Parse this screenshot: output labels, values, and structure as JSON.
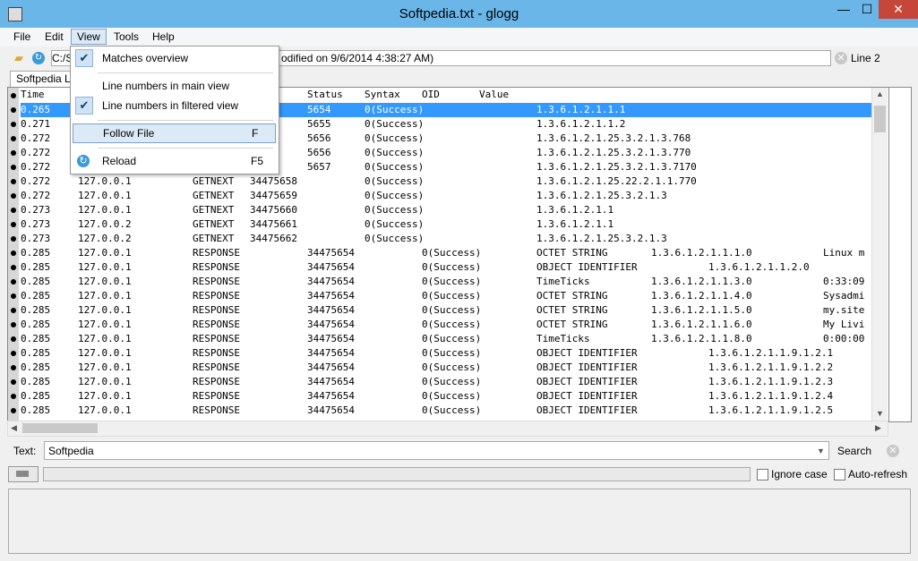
{
  "window": {
    "title": "Softpedia.txt - glogg",
    "min_label": "—",
    "max_label": "☐",
    "close_label": "✕"
  },
  "menubar": [
    "File",
    "Edit",
    "View",
    "Tools",
    "Help"
  ],
  "toolbar": {
    "path_prefix": "C:/S",
    "path_suffix": "odified on 9/6/2014 4:38:27 AM)",
    "line_indicator": "Line 2"
  },
  "tab": {
    "label": "Softpedia Lo"
  },
  "view_menu": {
    "items": [
      {
        "label": "Matches overview",
        "checked": true,
        "shortcut": ""
      },
      {
        "label": "Line numbers in main view",
        "checked": false,
        "shortcut": ""
      },
      {
        "label": "Line numbers in filtered view",
        "checked": true,
        "shortcut": ""
      },
      {
        "label": "Follow File",
        "checked": false,
        "shortcut": "F"
      },
      {
        "label": "Reload",
        "checked": false,
        "shortcut": "F5"
      }
    ]
  },
  "log": {
    "headers": [
      "Time",
      "Status",
      "Syntax",
      "OID",
      "Value"
    ],
    "rows": [
      [
        "0.265",
        "",
        "",
        "5654",
        "0(Success)",
        "1.3.6.1.2.1.1.1",
        "",
        ""
      ],
      [
        "0.271",
        "",
        "",
        "5655",
        "0(Success)",
        "1.3.6.1.2.1.1.2",
        "",
        ""
      ],
      [
        "0.272",
        "",
        "",
        "5656",
        "0(Success)",
        "1.3.6.1.2.1.25.3.2.1.3.768",
        "",
        ""
      ],
      [
        "0.272",
        "",
        "",
        "5656",
        "0(Success)",
        "1.3.6.1.2.1.25.3.2.1.3.770",
        "",
        ""
      ],
      [
        "0.272",
        "",
        "",
        "5657",
        "0(Success)",
        "1.3.6.1.2.1.25.3.2.1.3.7170",
        "",
        ""
      ],
      [
        "0.272",
        "127.0.0.1",
        "GETNEXT",
        "34475658",
        "0(Success)",
        "1.3.6.1.2.1.25.22.2.1.1.770",
        "",
        ""
      ],
      [
        "0.272",
        "127.0.0.1",
        "GETNEXT",
        "34475659",
        "0(Success)",
        "1.3.6.1.2.1.25.3.2.1.3",
        "",
        ""
      ],
      [
        "0.273",
        "127.0.0.1",
        "GETNEXT",
        "34475660",
        "0(Success)",
        "1.3.6.1.2.1.1",
        "",
        ""
      ],
      [
        "0.273",
        "127.0.0.2",
        "GETNEXT",
        "34475661",
        "0(Success)",
        "1.3.6.1.2.1.1",
        "",
        ""
      ],
      [
        "0.273",
        "127.0.0.2",
        "GETNEXT",
        "34475662",
        "0(Success)",
        "1.3.6.1.2.1.25.3.2.1.3",
        "",
        ""
      ],
      [
        "0.285",
        "127.0.0.1",
        "RESPONSE",
        "34475654",
        "0(Success)",
        "OCTET STRING",
        "1.3.6.1.2.1.1.1.0",
        "Linux m"
      ],
      [
        "0.285",
        "127.0.0.1",
        "RESPONSE",
        "34475654",
        "0(Success)",
        "OBJECT IDENTIFIER",
        "1.3.6.1.2.1.1.2.0",
        ""
      ],
      [
        "0.285",
        "127.0.0.1",
        "RESPONSE",
        "34475654",
        "0(Success)",
        "TimeTicks",
        "1.3.6.1.2.1.1.3.0",
        "0:33:09"
      ],
      [
        "0.285",
        "127.0.0.1",
        "RESPONSE",
        "34475654",
        "0(Success)",
        "OCTET STRING",
        "1.3.6.1.2.1.1.4.0",
        "Sysadmi"
      ],
      [
        "0.285",
        "127.0.0.1",
        "RESPONSE",
        "34475654",
        "0(Success)",
        "OCTET STRING",
        "1.3.6.1.2.1.1.5.0",
        "my.site"
      ],
      [
        "0.285",
        "127.0.0.1",
        "RESPONSE",
        "34475654",
        "0(Success)",
        "OCTET STRING",
        "1.3.6.1.2.1.1.6.0",
        "My Livi"
      ],
      [
        "0.285",
        "127.0.0.1",
        "RESPONSE",
        "34475654",
        "0(Success)",
        "TimeTicks",
        "1.3.6.1.2.1.1.8.0",
        "0:00:00"
      ],
      [
        "0.285",
        "127.0.0.1",
        "RESPONSE",
        "34475654",
        "0(Success)",
        "OBJECT IDENTIFIER",
        "1.3.6.1.2.1.1.9.1.2.1",
        ""
      ],
      [
        "0.285",
        "127.0.0.1",
        "RESPONSE",
        "34475654",
        "0(Success)",
        "OBJECT IDENTIFIER",
        "1.3.6.1.2.1.1.9.1.2.2",
        ""
      ],
      [
        "0.285",
        "127.0.0.1",
        "RESPONSE",
        "34475654",
        "0(Success)",
        "OBJECT IDENTIFIER",
        "1.3.6.1.2.1.1.9.1.2.3",
        ""
      ],
      [
        "0.285",
        "127.0.0.1",
        "RESPONSE",
        "34475654",
        "0(Success)",
        "OBJECT IDENTIFIER",
        "1.3.6.1.2.1.1.9.1.2.4",
        ""
      ],
      [
        "0.285",
        "127.0.0.1",
        "RESPONSE",
        "34475654",
        "0(Success)",
        "OBJECT IDENTIFIER",
        "1.3.6.1.2.1.1.9.1.2.5",
        ""
      ]
    ]
  },
  "search": {
    "label": "Text:",
    "value": "Softpedia",
    "button_label": "Search"
  },
  "options": {
    "ignore_case_label": "Ignore case",
    "auto_refresh_label": "Auto-refresh"
  },
  "colors": {
    "titlebar": "#6bb6e8",
    "selection": "#3399ff",
    "close_button": "#c7463a"
  }
}
